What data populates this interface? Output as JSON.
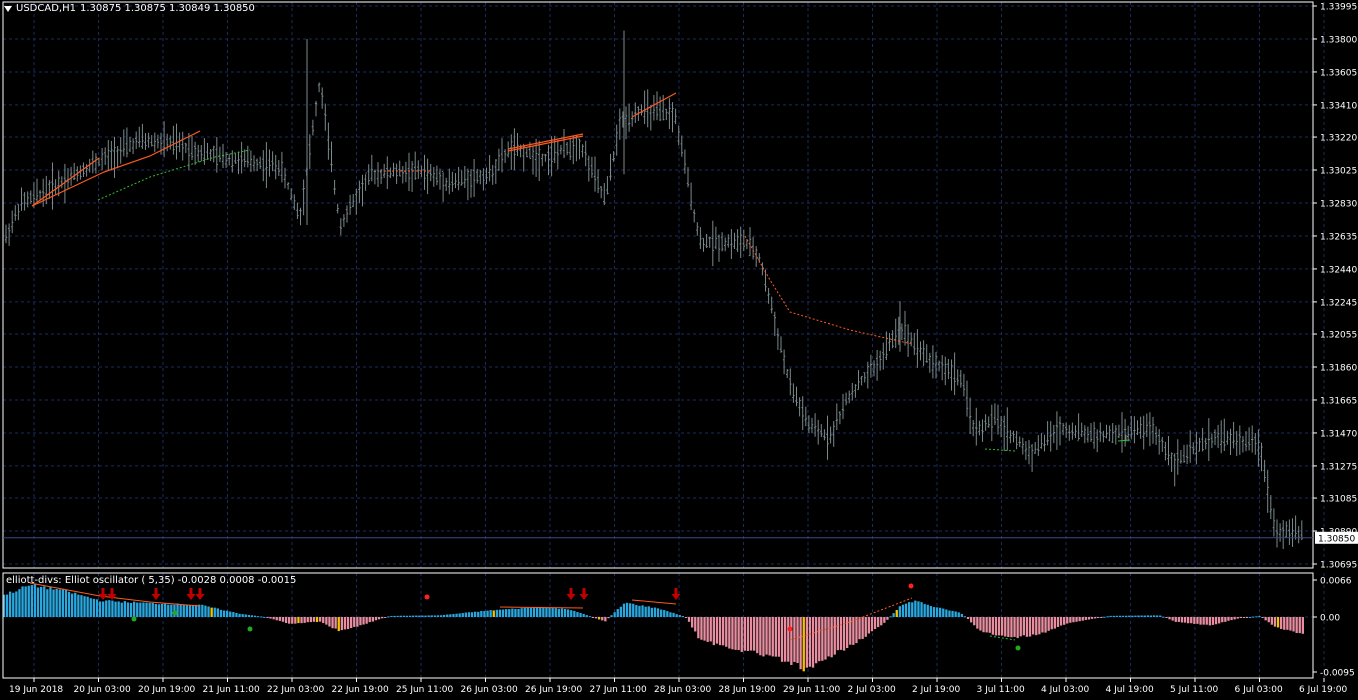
{
  "main_chart": {
    "symbol_label": "USDCAD,H1",
    "ohlc_label": "1.30875 1.30875 1.30849 1.30850",
    "price_labels": [
      "1.33995",
      "1.33800",
      "1.33605",
      "1.33410",
      "1.33220",
      "1.33025",
      "1.32830",
      "1.32635",
      "1.32440",
      "1.32245",
      "1.32055",
      "1.31860",
      "1.31665",
      "1.31470",
      "1.31275",
      "1.31085",
      "1.30890",
      "1.30695"
    ],
    "current_price": "1.30850",
    "time_labels": [
      "19 Jun 2018",
      "20 Jun 03:00",
      "20 Jun 19:00",
      "21 Jun 11:00",
      "22 Jun 03:00",
      "22 Jun 19:00",
      "25 Jun 11:00",
      "26 Jun 03:00",
      "26 Jun 19:00",
      "27 Jun 11:00",
      "28 Jun 03:00",
      "28 Jun 19:00",
      "29 Jun 11:00",
      "2 Jul 03:00",
      "2 Jul 19:00",
      "3 Jul 11:00",
      "4 Jul 03:00",
      "4 Jul 19:00",
      "5 Jul 11:00",
      "6 Jul 03:00",
      "6 Jul 19:00"
    ]
  },
  "indicator": {
    "title": "elliott-divs: Elliot oscillator ( 5,35) -0.0028 0.0008 -0.0015",
    "scale_labels": [
      "0.0066",
      "0.00",
      "-0.0095"
    ]
  },
  "colors": {
    "background": "#000000",
    "grid": "#1c2a5e",
    "candles": "#7a8a8c",
    "bull_hist": "#29a8e0",
    "bear_hist": "#e88ea0",
    "signal_hist": "#f5c400",
    "div_line": "#ff5a1f",
    "hidden_div": "#2fbf2f",
    "arrow": "#c00000",
    "dot_red": "#ff2020",
    "dot_green": "#1faa1f"
  }
}
